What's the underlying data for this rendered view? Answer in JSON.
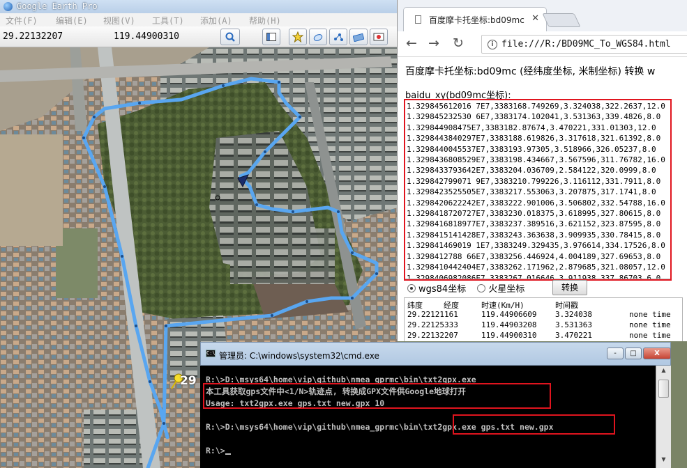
{
  "google_earth": {
    "title": "Google Earth Pro",
    "menu": [
      "文件(F)",
      "编辑(E)",
      "视图(V)",
      "工具(T)",
      "添加(A)",
      "帮助(H)"
    ],
    "lat": "29.22132207",
    "lon": "119.44900310",
    "tool_icons": [
      "search-icon",
      "sidebar-icon",
      "placemark-icon",
      "polygon-icon",
      "path-icon",
      "overlay-icon",
      "record-tour-icon"
    ],
    "pin_label": "29"
  },
  "browser": {
    "tab_title": "百度摩卡托坐标:bd09mc",
    "url": "file:///R:/BD09MC_To_WGS84.html",
    "heading": "百度摩卡托坐标:bd09mc (经纬度坐标, 米制坐标) 转换 w",
    "xy_label": "baidu_xy(bd09mc坐标):",
    "rows": [
      "1.329845612016 7E7,3383168.749269,3.324038,322.2637,12.0",
      "1.329845232530 6E7,3383174.102041,3.531363,339.4826,8.0",
      "1.329844908475E7,3383182.87674,3.470221,331.01303,12.0",
      "1.3298443840297E7,3383188.619826,3.317618,321.61392,8.0",
      "1.3298440045537E7,3383193.97305,3.518966,326.05237,8.0",
      "1.3298436808529E7,3383198.434667,3.567596,311.76782,16.0",
      "1.3298433793642E7,3383204.036709,2.584122,320.0999,8.0",
      "1.329842799071 9E7,3383210.799226,3.116112,331.7911,8.0",
      "1.3298423525505E7,3383217.553063,3.207875,317.1741,8.0",
      "1.3298420622242E7,3383222.901006,3.506802,332.54788,16.0",
      "1.3298418720727E7,3383230.018375,3.618995,327.80615,8.0",
      "1.3298416818977E7,3383237.389516,3.621152,323.87595,8.0",
      "1.3298415141428E7,3383243.363638,3.909935,330.78415,8.0",
      "1.329841469019 1E7,3383249.329435,3.976614,334.17526,8.0",
      "1.3298412788 66E7,3383256.446924,4.004189,327.69653,8.0",
      "1.3298410442404E7,3383262.171962,2.879685,321.08057,12.0",
      "1.3298406982086E7,3383267.016646,3.911938,337.86703,6.0"
    ],
    "radio_wgs84": "wgs84坐标",
    "radio_mars": "火星坐标",
    "convert_label": "转换",
    "out_headers": [
      "纬度",
      "经度",
      "时速(Km/H)",
      "时间戳"
    ],
    "out_rows": [
      [
        "29.22121161",
        "119.44906609",
        "3.324038",
        "none time"
      ],
      [
        "29.22125333",
        "119.44903208",
        "3.531363",
        "none time"
      ],
      [
        "29.22132207",
        "119.44900310",
        "3.470221",
        "none time"
      ]
    ]
  },
  "cmd": {
    "title": "管理员: C:\\windows\\system32\\cmd.exe",
    "lines": [
      "R:\\>D:\\msys64\\home\\vip\\github\\nmea_gprmc\\bin\\txt2gpx.exe",
      "本工具获取gps文件中<1/N>轨迹点, 转换成GPX文件供Google地球打开",
      "Usage: txt2gpx.exe  gps.txt  new.gpx  10",
      "",
      "R:\\>D:\\msys64\\home\\vip\\github\\nmea_gprmc\\bin\\txt2gpx.exe gps.txt new.gpx",
      "",
      "R:\\>"
    ],
    "minimize": "-",
    "maximize": "□",
    "close": "X"
  },
  "colors": {
    "track": "#59a6f0",
    "highlight": "#e0141e"
  }
}
